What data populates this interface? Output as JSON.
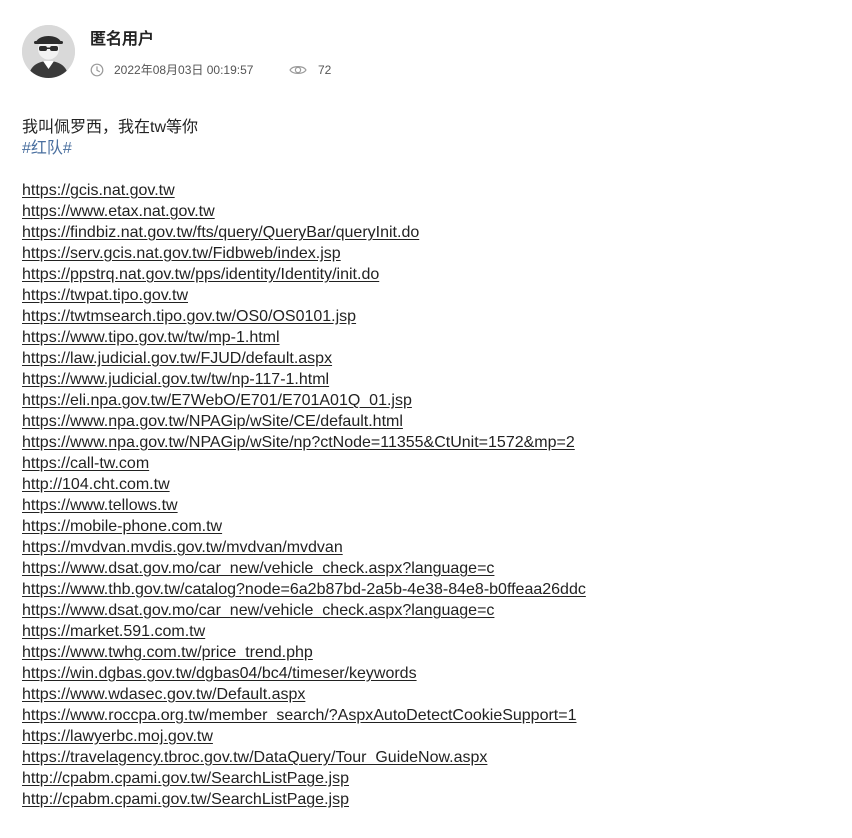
{
  "author": {
    "name": "匿名用户",
    "avatar_icon": "incognito-avatar-icon"
  },
  "meta": {
    "timestamp": "2022年08月03日 00:19:57",
    "views": "72",
    "clock_icon": "clock-icon",
    "views_icon": "eye-icon"
  },
  "post": {
    "intro": "我叫佩罗西，我在tw等你",
    "tag": "#红队#",
    "links": [
      "https://gcis.nat.gov.tw",
      "https://www.etax.nat.gov.tw",
      "https://findbiz.nat.gov.tw/fts/query/QueryBar/queryInit.do",
      "https://serv.gcis.nat.gov.tw/Fidbweb/index.jsp",
      "https://ppstrq.nat.gov.tw/pps/identity/Identity/init.do",
      "https://twpat.tipo.gov.tw",
      "https://twtmsearch.tipo.gov.tw/OS0/OS0101.jsp",
      "https://www.tipo.gov.tw/tw/mp-1.html",
      "https://law.judicial.gov.tw/FJUD/default.aspx",
      "https://www.judicial.gov.tw/tw/np-117-1.html",
      "https://eli.npa.gov.tw/E7WebO/E701/E701A01Q_01.jsp",
      "https://www.npa.gov.tw/NPAGip/wSite/CE/default.html",
      "https://www.npa.gov.tw/NPAGip/wSite/np?ctNode=11355&CtUnit=1572&mp=2",
      "https://call-tw.com",
      "http://104.cht.com.tw",
      "https://www.tellows.tw",
      "https://mobile-phone.com.tw",
      "https://mvdvan.mvdis.gov.tw/mvdvan/mvdvan",
      "https://www.dsat.gov.mo/car_new/vehicle_check.aspx?language=c",
      "https://www.thb.gov.tw/catalog?node=6a2b87bd-2a5b-4e38-84e8-b0ffeaa26ddc",
      "https://www.dsat.gov.mo/car_new/vehicle_check.aspx?language=c",
      "https://market.591.com.tw",
      "https://www.twhg.com.tw/price_trend.php",
      "https://win.dgbas.gov.tw/dgbas04/bc4/timeser/keywords",
      "https://www.wdasec.gov.tw/Default.aspx",
      "https://www.roccpa.org.tw/member_search/?AspxAutoDetectCookieSupport=1",
      "https://lawyerbc.moj.gov.tw",
      "https://travelagency.tbroc.gov.tw/DataQuery/Tour_GuideNow.aspx",
      "http://cpabm.cpami.gov.tw/SearchListPage.jsp",
      "http://cpabm.cpami.gov.tw/SearchListPage.jsp"
    ]
  },
  "colors": {
    "tag": "#4a6f9f",
    "text": "#222222",
    "meta": "#555555",
    "avatar_bg": "#d9d9d9"
  }
}
